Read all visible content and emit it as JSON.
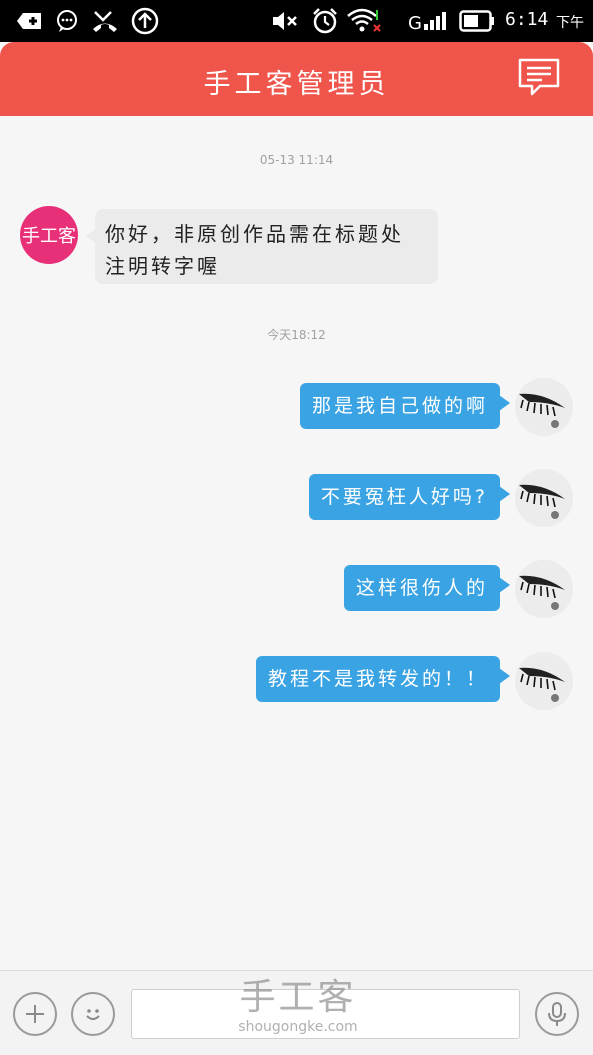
{
  "status_bar": {
    "time": "6:14",
    "ampm": "下午",
    "icons": [
      "usb-icon",
      "message-bubble-icon",
      "missed-call-icon",
      "upload-arrow-icon",
      "mute-icon",
      "alarm-icon",
      "wifi-icon",
      "signal-icon",
      "battery-icon"
    ]
  },
  "header": {
    "title": "手工客管理员",
    "bg_color": "#ef554b",
    "right_icon": "message-icon"
  },
  "chat": {
    "messages": [
      {
        "type": "timestamp",
        "text": "05-13 11:14"
      },
      {
        "type": "incoming",
        "avatar_text": "手工客",
        "text_line1": "你好，非原创作品需在标题处",
        "text_line2": "注明转字喔"
      },
      {
        "type": "timestamp",
        "text": "今天18:12"
      },
      {
        "type": "outgoing",
        "text": "那是我自己做的啊"
      },
      {
        "type": "outgoing",
        "text": "不要冤枉人好吗?"
      },
      {
        "type": "outgoing",
        "text": "这样很伤人的"
      },
      {
        "type": "outgoing",
        "text": "教程不是我转发的！！"
      }
    ],
    "bubble_out_color": "#3aa3e3",
    "bubble_in_color": "#ebebeb"
  },
  "input_bar": {
    "value": "",
    "placeholder": "",
    "buttons": [
      "plus-icon",
      "emoji-icon",
      "microphone-icon"
    ]
  },
  "watermark": {
    "cn": "手工客",
    "en": "shougongke.com"
  }
}
